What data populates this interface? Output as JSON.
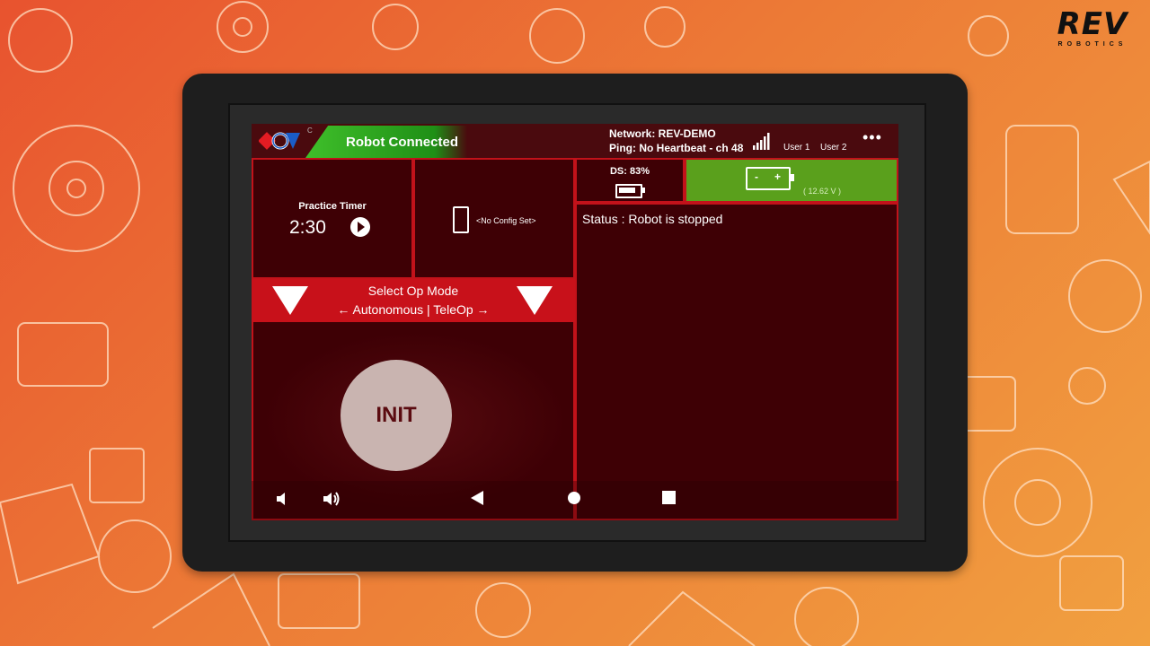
{
  "brand": {
    "name": "REV",
    "sub": "ROBOTICS"
  },
  "status_bar": {
    "connection": "Robot Connected",
    "corner_mark": "C",
    "network": "Network: REV-DEMO",
    "ping": "Ping: No Heartbeat - ch 48",
    "user1": "User 1",
    "user2": "User 2",
    "menu": "•••"
  },
  "timer": {
    "title": "Practice Timer",
    "value": "2:30"
  },
  "config": {
    "label": "<No Config Set>"
  },
  "ds": {
    "label": "DS: 83%",
    "battery_level": 0.83
  },
  "robot_battery": {
    "minus": "-",
    "plus": "+",
    "voltage": "( 12.62 V )",
    "color": "#5aa01c"
  },
  "status": {
    "text": "Status : Robot is stopped"
  },
  "op_mode": {
    "title": "Select Op Mode",
    "subtitle": "← Autonomous | TeleOp →"
  },
  "init_button": {
    "label": "INIT"
  },
  "colors": {
    "accent_red": "#c8111a",
    "panel_bg": "#3e0005",
    "connected_green": "#3fbf2a"
  }
}
